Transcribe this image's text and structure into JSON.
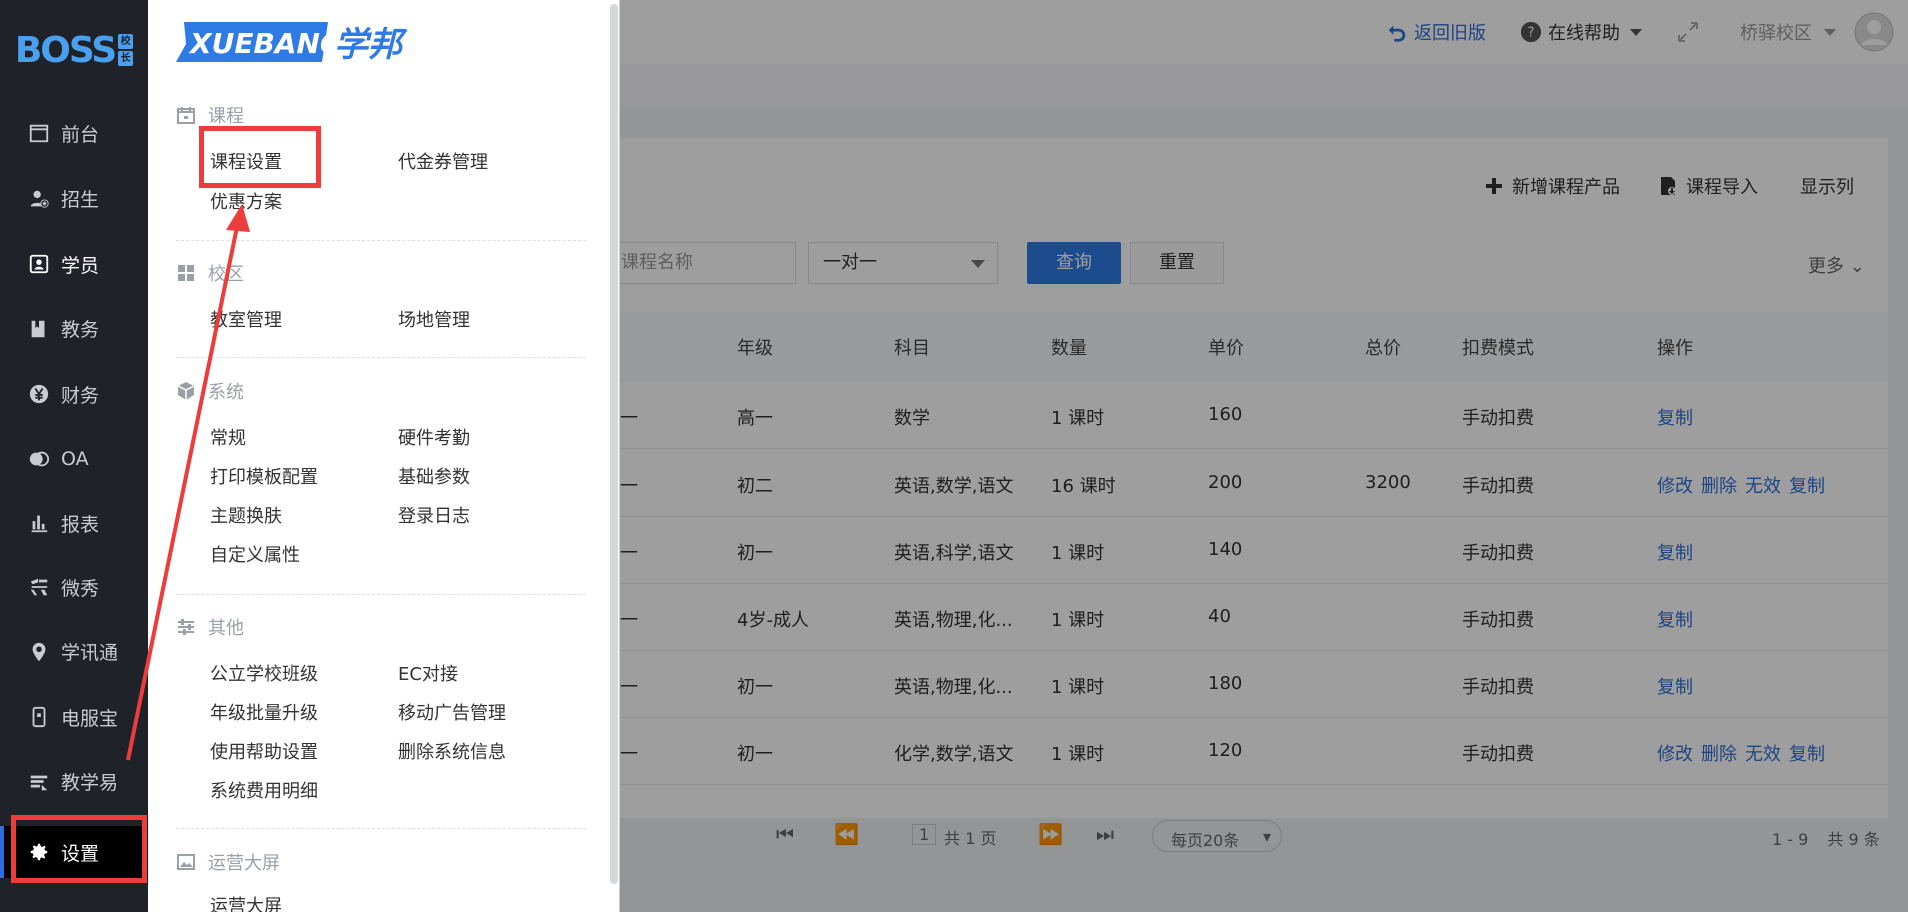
{
  "sidebar": {
    "logo": {
      "main": "BOSS",
      "tag": [
        "校",
        "长"
      ]
    },
    "items": [
      {
        "label": "前台",
        "icon": "calendar-icon"
      },
      {
        "label": "招生",
        "icon": "user-add-icon"
      },
      {
        "label": "学员",
        "icon": "student-card-icon"
      },
      {
        "label": "教务",
        "icon": "book-icon"
      },
      {
        "label": "财务",
        "icon": "yen-icon"
      },
      {
        "label": "OA",
        "icon": "oa-icon"
      },
      {
        "label": "报表",
        "icon": "bar-chart-icon"
      },
      {
        "label": "微秀",
        "icon": "weixiu-icon"
      },
      {
        "label": "学讯通",
        "icon": "location-icon"
      },
      {
        "label": "电服宝",
        "icon": "phone-icon"
      },
      {
        "label": "教学易",
        "icon": "teaching-icon"
      },
      {
        "label": "设置",
        "icon": "gear-icon"
      }
    ]
  },
  "header": {
    "back_old": "返回旧版",
    "help": "在线帮助",
    "campus": "桥驿校区"
  },
  "toolbar": {
    "add_course": "新增课程产品",
    "import_course": "课程导入",
    "show_columns": "显示列"
  },
  "filters": {
    "course_name_placeholder": "课程名称",
    "type_value": "一对一",
    "query": "查询",
    "reset": "重置",
    "more": "更多"
  },
  "table": {
    "headers": [
      "年级",
      "科目",
      "数量",
      "单价",
      "总价",
      "扣费模式",
      "操作"
    ],
    "rows": [
      {
        "lead": "一",
        "grade": "高一",
        "subject": "数学",
        "qty": "1 课时",
        "unit": "160",
        "total": "",
        "mode": "手动扣费",
        "ops": [
          "复制"
        ]
      },
      {
        "lead": "一",
        "grade": "初二",
        "subject": "英语,数学,语文",
        "qty": "16 课时",
        "unit": "200",
        "total": "3200",
        "mode": "手动扣费",
        "ops": [
          "修改",
          "删除",
          "无效",
          "复制"
        ]
      },
      {
        "lead": "一",
        "grade": "初一",
        "subject": "英语,科学,语文",
        "qty": "1 课时",
        "unit": "140",
        "total": "",
        "mode": "手动扣费",
        "ops": [
          "复制"
        ]
      },
      {
        "lead": "一",
        "grade": "4岁-成人",
        "subject": "英语,物理,化...",
        "qty": "1 课时",
        "unit": "40",
        "total": "",
        "mode": "手动扣费",
        "ops": [
          "复制"
        ]
      },
      {
        "lead": "一",
        "grade": "初一",
        "subject": "英语,物理,化...",
        "qty": "1 课时",
        "unit": "180",
        "total": "",
        "mode": "手动扣费",
        "ops": [
          "复制"
        ]
      },
      {
        "lead": "一",
        "grade": "初一",
        "subject": "化学,数学,语文",
        "qty": "1 课时",
        "unit": "120",
        "total": "",
        "mode": "手动扣费",
        "ops": [
          "修改",
          "删除",
          "无效",
          "复制"
        ]
      }
    ]
  },
  "pagination": {
    "page": "1",
    "total_pages": "共 1 页",
    "per_page": "每页20条",
    "range": "1 - 9",
    "total": "共 9 条"
  },
  "menu": {
    "brand": {
      "latin": "XUEBANG",
      "cn": "学邦"
    },
    "sections": [
      {
        "title": "课程",
        "icon": "course-calendar-icon",
        "items": [
          "课程设置",
          "代金券管理",
          "优惠方案"
        ]
      },
      {
        "title": "校区",
        "icon": "campus-grid-icon",
        "items": [
          "教室管理",
          "场地管理"
        ]
      },
      {
        "title": "系统",
        "icon": "cube-icon",
        "items": [
          "常规",
          "硬件考勤",
          "打印模板配置",
          "基础参数",
          "主题换肤",
          "登录日志",
          "自定义属性"
        ]
      },
      {
        "title": "其他",
        "icon": "sliders-icon",
        "items": [
          "公立学校班级",
          "EC对接",
          "年级批量升级",
          "移动广告管理",
          "使用帮助设置",
          "删除系统信息",
          "系统费用明细"
        ]
      },
      {
        "title": "运营大屏",
        "icon": "image-icon",
        "items": [
          "运营大屏"
        ]
      }
    ]
  },
  "colors": {
    "accent": "#2f7be6",
    "annotation": "#ee3b3b",
    "sidebar": "#1f2329"
  }
}
